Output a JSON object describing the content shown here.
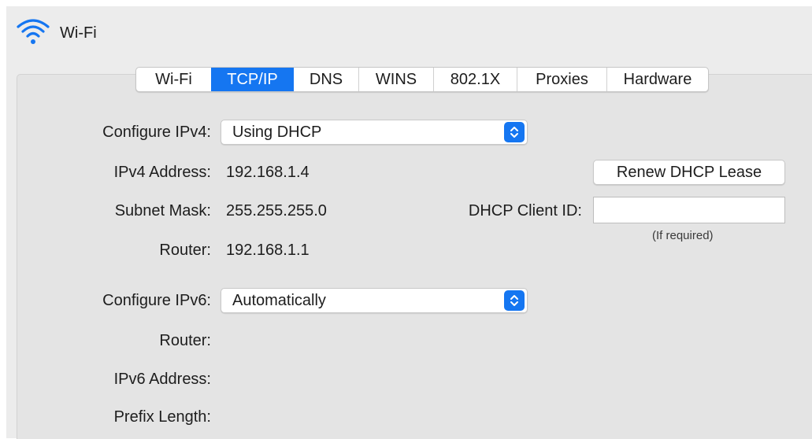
{
  "window": {
    "title": "Wi-Fi",
    "icon": "wifi-icon"
  },
  "tabs": [
    {
      "label": "Wi-Fi",
      "active": false
    },
    {
      "label": "TCP/IP",
      "active": true
    },
    {
      "label": "DNS",
      "active": false
    },
    {
      "label": "WINS",
      "active": false
    },
    {
      "label": "802.1X",
      "active": false
    },
    {
      "label": "Proxies",
      "active": false
    },
    {
      "label": "Hardware",
      "active": false
    }
  ],
  "ipv4": {
    "configure_label": "Configure IPv4:",
    "configure_value": "Using DHCP",
    "address_label": "IPv4 Address:",
    "address_value": "192.168.1.4",
    "subnet_label": "Subnet Mask:",
    "subnet_value": "255.255.255.0",
    "router_label": "Router:",
    "router_value": "192.168.1.1"
  },
  "dhcp": {
    "renew_button": "Renew DHCP Lease",
    "client_id_label": "DHCP Client ID:",
    "client_id_value": "",
    "client_id_hint": "(If required)"
  },
  "ipv6": {
    "configure_label": "Configure IPv6:",
    "configure_value": "Automatically",
    "router_label": "Router:",
    "router_value": "",
    "address_label": "IPv6 Address:",
    "address_value": "",
    "prefix_label": "Prefix Length:",
    "prefix_value": ""
  },
  "colors": {
    "accent": "#1576f1",
    "panel_bg": "#e4e4e4",
    "window_bg": "#ececec"
  }
}
